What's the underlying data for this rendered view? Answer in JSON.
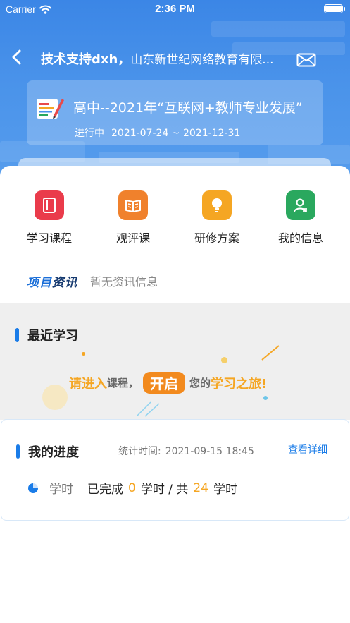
{
  "status_bar": {
    "carrier": "Carrier",
    "time": "2:36 PM"
  },
  "nav": {
    "title_bold": "技术支持dxh，",
    "title_rest": "山东新世纪网络教育有限...",
    "back_icon": "chevron-left-icon",
    "mail_icon": "envelope-icon"
  },
  "project": {
    "title": "高中--2021年“互联网+教师专业发展”",
    "status": "进行中",
    "dates": "2021-07-24 ~ 2021-12-31"
  },
  "menu": [
    {
      "label": "学习课程",
      "icon": "book-icon",
      "color": "#ea3b4b"
    },
    {
      "label": "观评课",
      "icon": "open-book-icon",
      "color": "#f0812c"
    },
    {
      "label": "研修方案",
      "icon": "lightbulb-icon",
      "color": "#f5a623"
    },
    {
      "label": "我的信息",
      "icon": "user-icon",
      "color": "#2aa85e"
    }
  ],
  "news": {
    "brand_a": "项目",
    "brand_b": "资讯",
    "empty_text": "暂无资讯信息"
  },
  "recent": {
    "title": "最近学习",
    "promo_a": "请进入",
    "promo_b": "课程，",
    "promo_pill": "开启",
    "promo_c": "您的",
    "promo_d": "学习之旅!"
  },
  "progress": {
    "title": "我的进度",
    "stat_label": "统计时间:",
    "stat_value": "2021-09-15 18:45",
    "detail_link": "查看详细",
    "unit_label": "学时",
    "completed_label": "已完成",
    "completed_value": "0",
    "middle_text": "学时 / 共",
    "total_value": "24",
    "end_text": "学时"
  }
}
